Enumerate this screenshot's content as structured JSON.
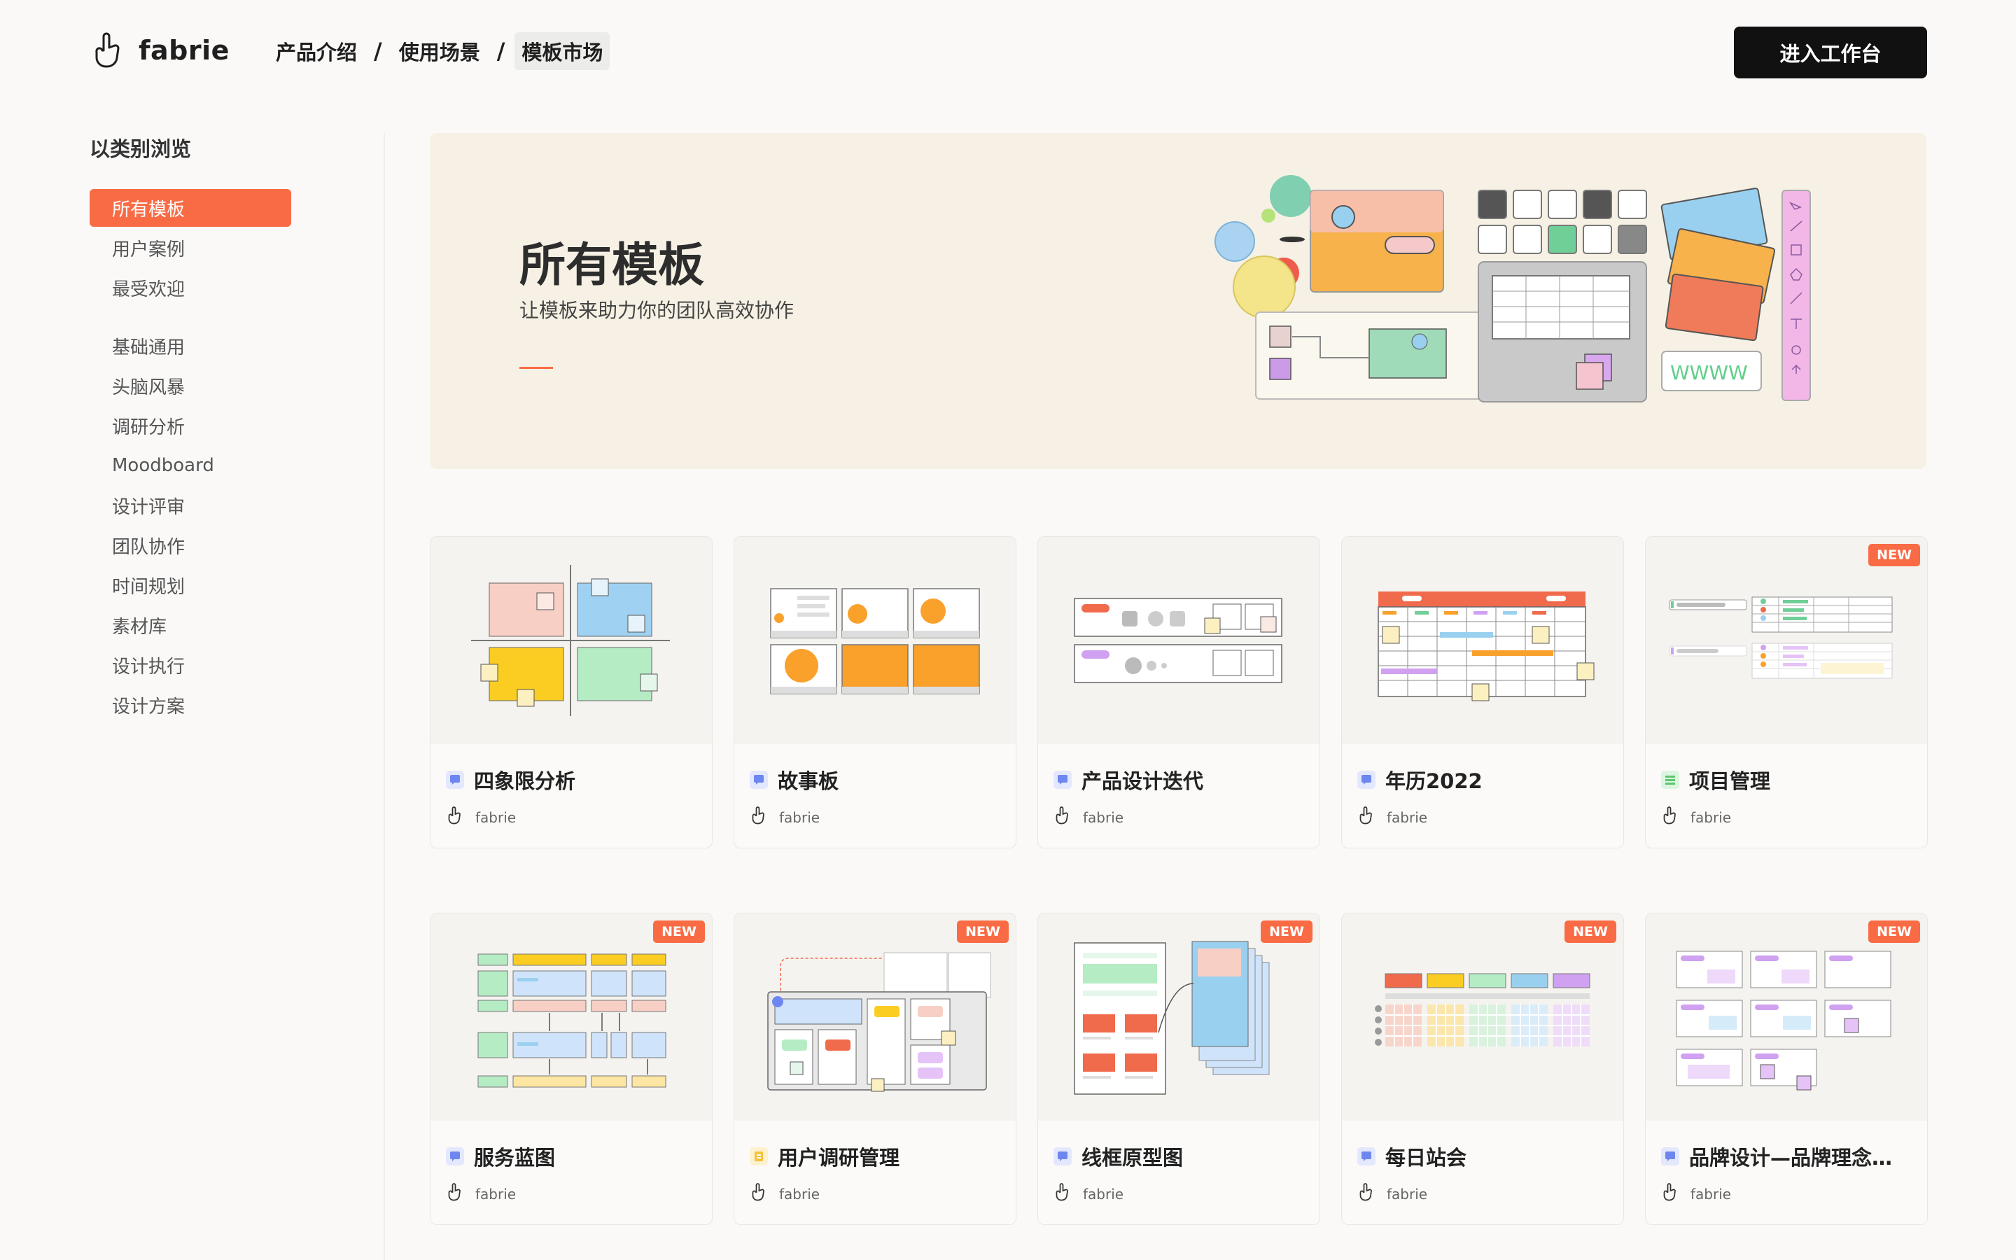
{
  "header": {
    "logo_text": "fabrie",
    "breadcrumb": [
      "产品介绍",
      "使用场景",
      "模板市场"
    ],
    "cta_label": "进入工作台"
  },
  "sidebar": {
    "title": "以类别浏览",
    "group1": [
      "所有模板",
      "用户案例",
      "最受欢迎"
    ],
    "group2": [
      "基础通用",
      "头脑风暴",
      "调研分析",
      "Moodboard",
      "设计评审",
      "团队协作",
      "时间规划",
      "素材库",
      "设计执行",
      "设计方案"
    ]
  },
  "hero": {
    "title": "所有模板",
    "subtitle": "让模板来助力你的团队高效协作",
    "art_text": "WWWW"
  },
  "cards": [
    {
      "title": "四象限分析",
      "author": "fabrie",
      "badge": "",
      "icon": "whiteboard-icon",
      "icon_color": "#6e86f0"
    },
    {
      "title": "故事板",
      "author": "fabrie",
      "badge": "",
      "icon": "whiteboard-icon",
      "icon_color": "#6e86f0"
    },
    {
      "title": "产品设计迭代",
      "author": "fabrie",
      "badge": "",
      "icon": "whiteboard-icon",
      "icon_color": "#6e86f0"
    },
    {
      "title": "年历2022",
      "author": "fabrie",
      "badge": "",
      "icon": "whiteboard-icon",
      "icon_color": "#6e86f0"
    },
    {
      "title": "项目管理",
      "author": "fabrie",
      "badge": "NEW",
      "icon": "table-icon",
      "icon_color": "#5fc56f"
    },
    {
      "title": "服务蓝图",
      "author": "fabrie",
      "badge": "NEW",
      "icon": "whiteboard-icon",
      "icon_color": "#6e86f0"
    },
    {
      "title": "用户调研管理",
      "author": "fabrie",
      "badge": "NEW",
      "icon": "document-icon",
      "icon_color": "#f5c23c"
    },
    {
      "title": "线框原型图",
      "author": "fabrie",
      "badge": "NEW",
      "icon": "whiteboard-icon",
      "icon_color": "#6e86f0"
    },
    {
      "title": "每日站会",
      "author": "fabrie",
      "badge": "NEW",
      "icon": "whiteboard-icon",
      "icon_color": "#6e86f0"
    },
    {
      "title": "品牌设计—品牌理念…",
      "author": "fabrie",
      "badge": "NEW",
      "icon": "whiteboard-icon",
      "icon_color": "#6e86f0"
    }
  ],
  "colors": {
    "accent": "#f96b45",
    "cta": "#111111"
  }
}
